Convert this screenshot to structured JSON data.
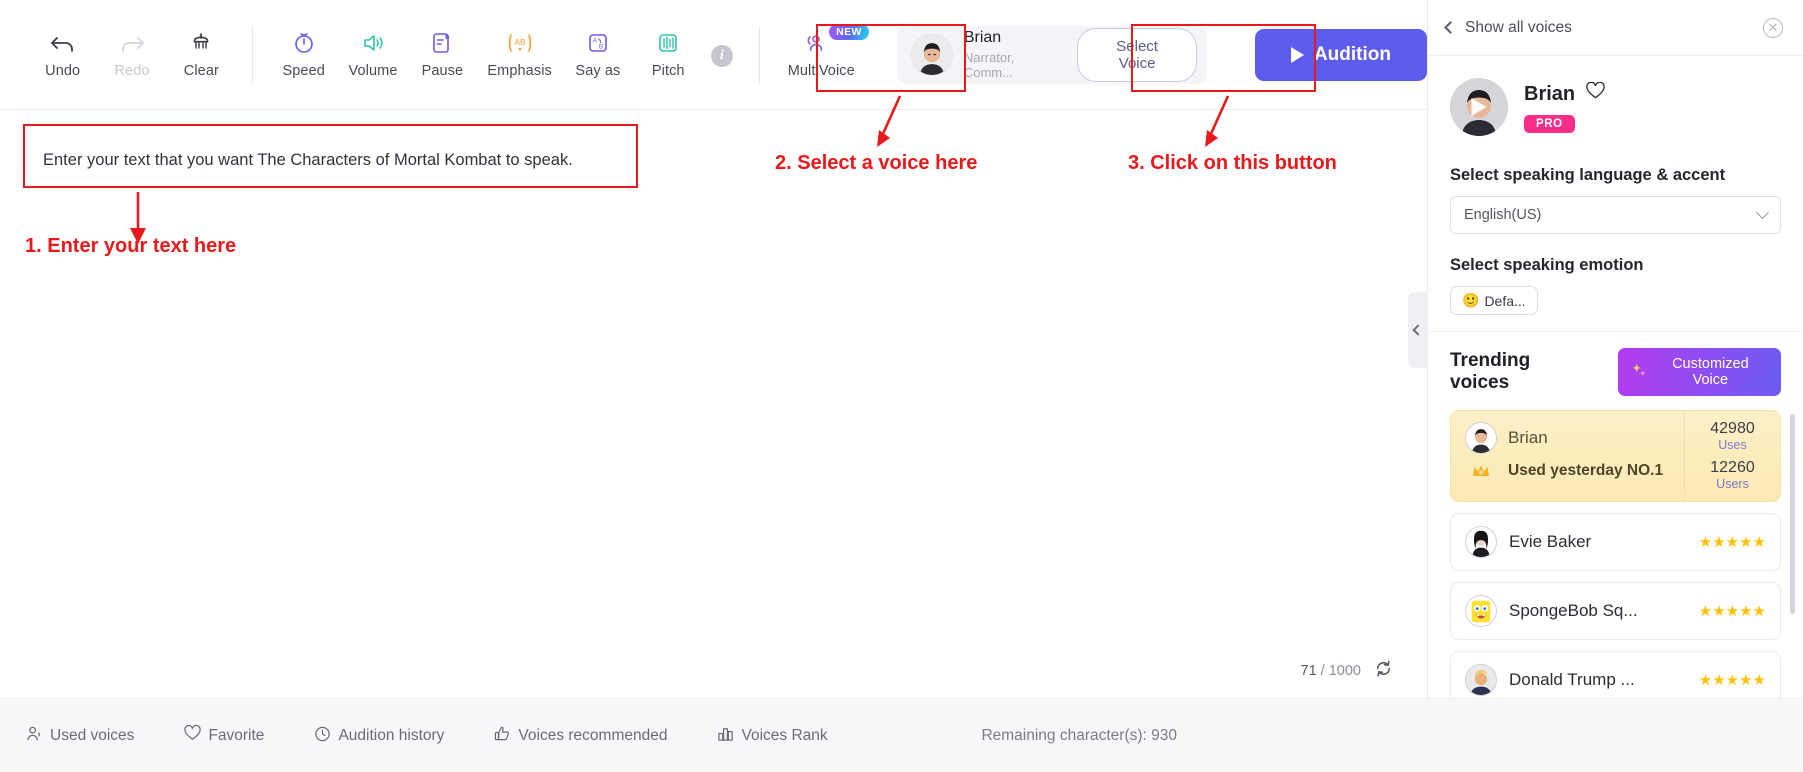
{
  "toolbar": {
    "tools": [
      {
        "label": "Undo",
        "icon": "undo-icon",
        "disabled": false
      },
      {
        "label": "Redo",
        "icon": "redo-icon",
        "disabled": true
      },
      {
        "label": "Clear",
        "icon": "clear-icon",
        "disabled": false
      }
    ],
    "effects": [
      {
        "label": "Speed",
        "icon": "speed-icon"
      },
      {
        "label": "Volume",
        "icon": "volume-icon"
      },
      {
        "label": "Pause",
        "icon": "pause-icon"
      },
      {
        "label": "Emphasis",
        "icon": "emphasis-icon"
      },
      {
        "label": "Say as",
        "icon": "say-as-icon"
      },
      {
        "label": "Pitch",
        "icon": "pitch-icon"
      }
    ],
    "info_tooltip": "i",
    "multivoice": {
      "label": "MultiVoice",
      "badge": "NEW"
    },
    "voice_chip": {
      "name": "Brian",
      "tags": "Narrator, Comm..."
    },
    "select_voice_label": "Select Voice",
    "audition_label": "Audition"
  },
  "editor": {
    "text": "Enter your text that you want The Characters of Mortal Kombat to speak.",
    "char_current": "71",
    "char_sep": "/",
    "char_max": "1000"
  },
  "bottom_bar": {
    "items": [
      {
        "label": "Used voices",
        "icon": "used-voices-icon"
      },
      {
        "label": "Favorite",
        "icon": "heart-icon"
      },
      {
        "label": "Audition history",
        "icon": "history-icon"
      },
      {
        "label": "Voices recommended",
        "icon": "thumbs-up-icon"
      },
      {
        "label": "Voices Rank",
        "icon": "bar-chart-icon"
      }
    ],
    "remaining": "Remaining character(s): 930"
  },
  "sidebar": {
    "back_label": "Show all voices",
    "close_icon": "close-icon",
    "voice": {
      "name": "Brian",
      "favorite_icon": "heart-icon",
      "badge": "PRO"
    },
    "language_label": "Select speaking language & accent",
    "language_value": "English(US)",
    "emotion_label": "Select speaking emotion",
    "emotion_chip": {
      "emoji": "🙂",
      "label": "Defa..."
    },
    "trending_title": "Trending voices",
    "customized_button": {
      "label": "Customized Voice",
      "icon": "sparkle-icon"
    },
    "featured": {
      "name": "Brian",
      "note": "Used yesterday NO.1",
      "crown_icon": "crown-icon",
      "uses_count": "42980",
      "uses_caption": "Uses",
      "users_count": "12260",
      "users_caption": "Users"
    },
    "voices": [
      {
        "name": "Evie Baker",
        "stars": "★★★★★",
        "avatar": "evie"
      },
      {
        "name": "SpongeBob Sq...",
        "stars": "★★★★★",
        "avatar": "spongebob"
      },
      {
        "name": "Donald Trump ...",
        "stars": "★★★★★",
        "avatar": "trump"
      }
    ]
  },
  "annotations": [
    {
      "id": "a1",
      "text": "1. Enter your text here"
    },
    {
      "id": "a2",
      "text": "2. Select a voice here"
    },
    {
      "id": "a3",
      "text": "3. Click on this button"
    }
  ],
  "colors": {
    "accent": "#5e5ced",
    "annotation": "#e8191b",
    "pro_badge": "#fa2d8a",
    "star": "#ffc107"
  }
}
